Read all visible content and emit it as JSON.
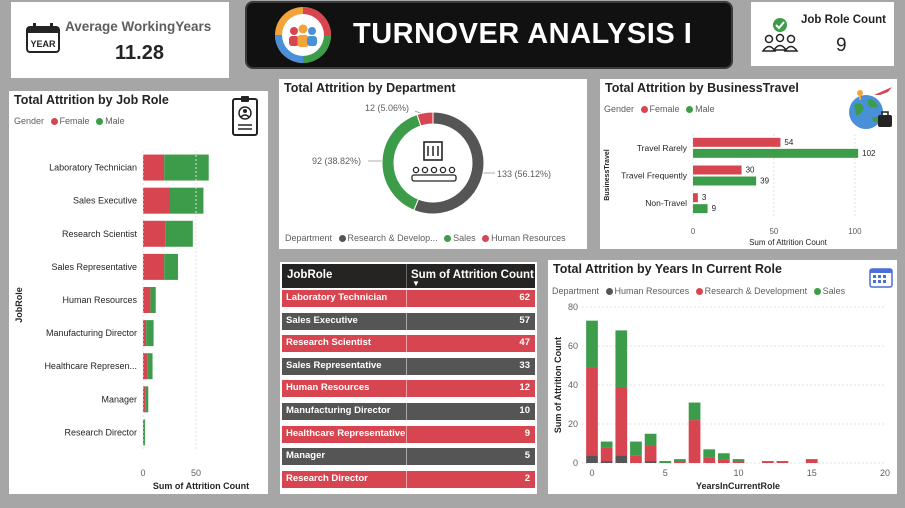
{
  "kpi_years": {
    "label": "Average WorkingYears",
    "value": "11.28",
    "icon_text": "YEAR"
  },
  "banner": {
    "title": "TURNOVER ANALYSIS I"
  },
  "kpi_roles": {
    "label": "Job Role Count",
    "value": "9"
  },
  "colors": {
    "female": "#d64550",
    "male": "#3d9c4a",
    "hr": "#d64550",
    "rd": "#555555",
    "sales": "#3d9c4a",
    "banner_bg": "#111111",
    "page_bg": "#a6a6a6"
  },
  "job_role_chart": {
    "title": "Total Attrition by Job Role",
    "legend_title": "Gender",
    "legend_female": "Female",
    "legend_male": "Male",
    "xlabel": "Sum of Attrition Count",
    "ylabel": "JobRole",
    "ticks": [
      "0",
      "50"
    ]
  },
  "dept_chart": {
    "title": "Total Attrition by Department",
    "legend_title": "Department",
    "legend_rd": "Research & Develop...",
    "legend_sales": "Sales",
    "legend_hr": "Human Resources",
    "label_rd": "133 (56.12%)",
    "label_sales": "92 (38.82%)",
    "label_hr": "12 (5.06%)"
  },
  "travel_chart": {
    "title": "Total Attrition by BusinessTravel",
    "legend_title": "Gender",
    "legend_female": "Female",
    "legend_male": "Male",
    "xlabel": "Sum of Attrition Count",
    "ylabel": "BusinessTravel",
    "ticks": [
      "0",
      "50",
      "100"
    ]
  },
  "table": {
    "col1": "JobRole",
    "col2": "Sum of Attrition Count",
    "rows": [
      {
        "role": "Laboratory Technician",
        "count": "62"
      },
      {
        "role": "Sales Executive",
        "count": "57"
      },
      {
        "role": "Research Scientist",
        "count": "47"
      },
      {
        "role": "Sales Representative",
        "count": "33"
      },
      {
        "role": "Human Resources",
        "count": "12"
      },
      {
        "role": "Manufacturing Director",
        "count": "10"
      },
      {
        "role": "Healthcare Representative",
        "count": "9"
      },
      {
        "role": "Manager",
        "count": "5"
      },
      {
        "role": "Research Director",
        "count": "2"
      }
    ]
  },
  "years_chart": {
    "title": "Total Attrition by Years In Current Role",
    "legend_title": "Department",
    "legend_hr": "Human Resources",
    "legend_rd": "Research & Development",
    "legend_sales": "Sales",
    "xlabel": "YearsInCurrentRole",
    "ylabel": "Sum of Attrition Count",
    "xticks": [
      "0",
      "5",
      "10",
      "15",
      "20"
    ],
    "yticks": [
      "0",
      "20",
      "40",
      "60",
      "80"
    ]
  },
  "chart_data": [
    {
      "type": "bar",
      "orientation": "horizontal",
      "title": "Total Attrition by Job Role",
      "categories": [
        "Laboratory Technician",
        "Sales Executive",
        "Research Scientist",
        "Sales Representative",
        "Human Resources",
        "Manufacturing Director",
        "Healthcare Represen...",
        "Manager",
        "Research Director"
      ],
      "series": [
        {
          "name": "Female",
          "values": [
            20,
            25,
            21,
            20,
            7,
            3,
            4,
            2,
            1
          ]
        },
        {
          "name": "Male",
          "values": [
            42,
            32,
            26,
            13,
            5,
            7,
            5,
            3,
            1
          ]
        }
      ],
      "xlim": [
        0,
        100
      ]
    },
    {
      "type": "pie",
      "title": "Total Attrition by Department",
      "categories": [
        "Research & Development",
        "Sales",
        "Human Resources"
      ],
      "values": [
        133,
        92,
        12
      ],
      "percent": [
        56.12,
        38.82,
        5.06
      ]
    },
    {
      "type": "bar",
      "orientation": "horizontal",
      "title": "Total Attrition by BusinessTravel",
      "categories": [
        "Travel Rarely",
        "Travel Frequently",
        "Non-Travel"
      ],
      "series": [
        {
          "name": "Female",
          "values": [
            54,
            30,
            3
          ]
        },
        {
          "name": "Male",
          "values": [
            102,
            39,
            9
          ]
        }
      ],
      "xlim": [
        0,
        105
      ]
    },
    {
      "type": "bar",
      "stacked": true,
      "title": "Total Attrition by Years In Current Role",
      "x": [
        0,
        1,
        2,
        3,
        4,
        5,
        6,
        7,
        8,
        9,
        10,
        11,
        12,
        13,
        14,
        15
      ],
      "series": [
        {
          "name": "Human Resources",
          "values": [
            4,
            1,
            4,
            0,
            1,
            0,
            0,
            0,
            0,
            0,
            0,
            0,
            0,
            0,
            0,
            0
          ]
        },
        {
          "name": "Research & Development",
          "values": [
            45,
            7,
            35,
            4,
            8,
            0,
            1,
            22,
            3,
            2,
            1,
            0,
            1,
            1,
            0,
            2
          ]
        },
        {
          "name": "Sales",
          "values": [
            24,
            3,
            29,
            7,
            6,
            1,
            1,
            9,
            4,
            3,
            1,
            0,
            0,
            0,
            0,
            0
          ]
        }
      ],
      "xlim": [
        0,
        20
      ],
      "ylim": [
        0,
        80
      ]
    }
  ]
}
